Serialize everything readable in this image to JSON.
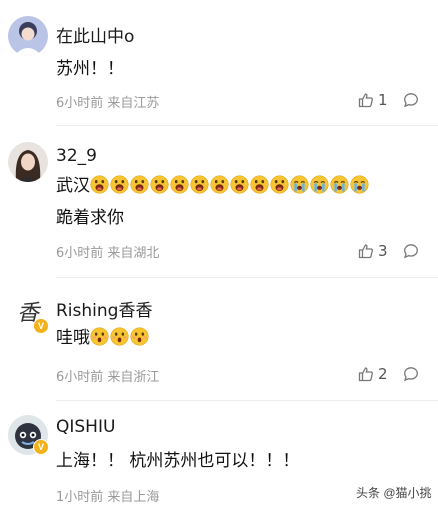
{
  "comments": [
    {
      "username": "在此山中o",
      "lines": [
        "苏州！！"
      ],
      "emoji": [],
      "meta": "6小时前 来自江苏",
      "likes": "1",
      "verified": false
    },
    {
      "username": "32_9",
      "lines": [
        "武汉",
        "跪着求你"
      ],
      "emoji": [
        "screaming-face",
        "screaming-face",
        "screaming-face",
        "screaming-face",
        "screaming-face",
        "screaming-face",
        "screaming-face",
        "screaming-face",
        "screaming-face",
        "screaming-face",
        "crying-face",
        "crying-face",
        "crying-face",
        "crying-face"
      ],
      "meta": "6小时前 来自湖北",
      "likes": "3",
      "verified": false
    },
    {
      "username": "Rishing香香",
      "lines": [
        "哇哦"
      ],
      "emoji": [
        "astonished-face",
        "astonished-face",
        "astonished-face"
      ],
      "meta": "6小时前 来自浙江",
      "likes": "2",
      "verified": true,
      "avatar_glyph": "香"
    },
    {
      "username": "QISHIU",
      "lines": [
        "上海！！ 杭州苏州也可以！！！"
      ],
      "emoji": [],
      "meta": "1小时前 来自上海",
      "likes": "",
      "verified": true
    }
  ],
  "badge_glyph": "V",
  "watermark": "头条 @猫小挑",
  "colors": {
    "badge": "#f3b21a",
    "meta": "#9a9a9a",
    "divider": "#ececec"
  }
}
